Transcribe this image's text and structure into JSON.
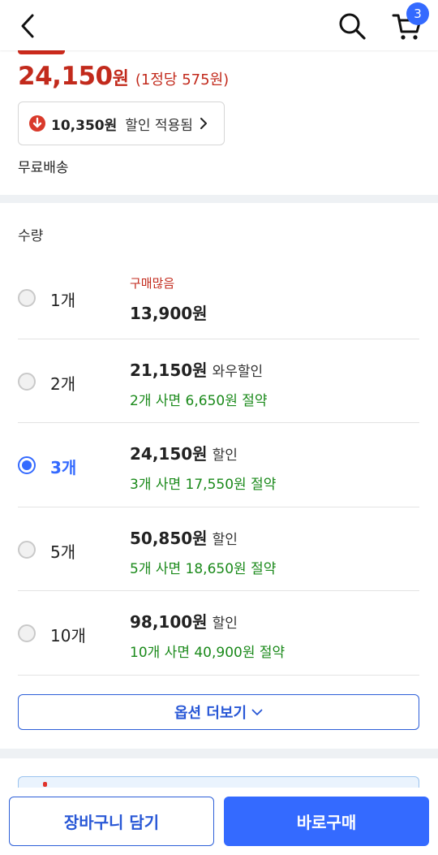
{
  "header": {
    "back_icon": "chevron-left-icon",
    "search_icon": "search-icon",
    "cart_icon": "cart-icon",
    "cart_count": "3"
  },
  "price": {
    "amount": "24,150",
    "currency": "원",
    "unit_price": "(1정당 575원)"
  },
  "coupon": {
    "icon": "down-arrow-circle-icon",
    "amount": "10,350원",
    "text": "할인 적용됨"
  },
  "shipping": "무료배송",
  "quantity_label": "수량",
  "options": [
    {
      "qty": "1개",
      "tag": "구매많음",
      "price": "13,900원",
      "note": "",
      "saving": "",
      "selected": false
    },
    {
      "qty": "2개",
      "tag": "",
      "price": "21,150원",
      "note": "와우할인",
      "saving": "2개 사면 6,650원 절약",
      "selected": false
    },
    {
      "qty": "3개",
      "tag": "",
      "price": "24,150원",
      "note": "할인",
      "saving": "3개 사면 17,550원 절약",
      "selected": true
    },
    {
      "qty": "5개",
      "tag": "",
      "price": "50,850원",
      "note": "할인",
      "saving": "5개 사면 18,650원 절약",
      "selected": false
    },
    {
      "qty": "10개",
      "tag": "",
      "price": "98,100원",
      "note": "할인",
      "saving": "10개 사면 40,900원 절약",
      "selected": false
    }
  ],
  "more_options": "옵션 더보기",
  "bottom": {
    "add_to_cart": "장바구니 담기",
    "buy_now": "바로구매"
  },
  "colors": {
    "accent": "#346aff",
    "price_red": "#c22a1c",
    "saving_green": "#1b8a1b"
  }
}
